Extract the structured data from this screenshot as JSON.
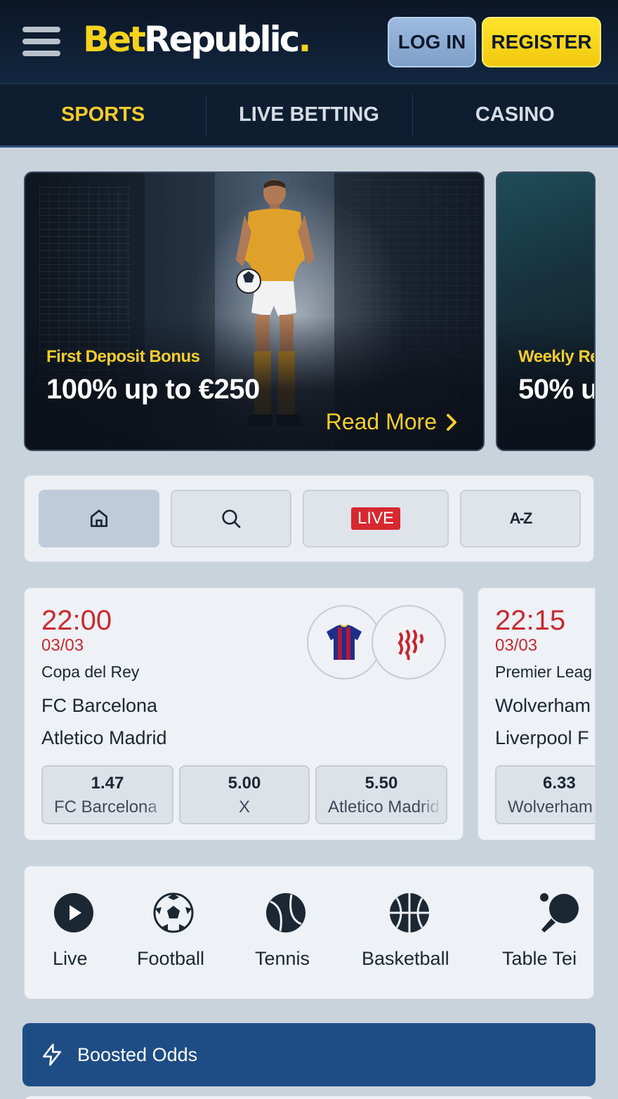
{
  "header": {
    "logo_part1": "Bet",
    "logo_part2": "Republic",
    "logo_dot": ".",
    "login_label": "LOG IN",
    "register_label": "REGISTER",
    "colors": {
      "brand_yellow": "#f7d21c",
      "header_bg": "#0c1626"
    }
  },
  "nav": {
    "tabs": [
      {
        "label": "SPORTS",
        "active": true
      },
      {
        "label": "LIVE BETTING",
        "active": false
      },
      {
        "label": "CASINO",
        "active": false
      }
    ]
  },
  "promos": [
    {
      "subtitle": "First Deposit Bonus",
      "title": "100% up to €250",
      "cta": "Read More"
    },
    {
      "subtitle": "Weekly Re",
      "title": "50% u"
    }
  ],
  "filters": {
    "items": [
      {
        "icon": "home-icon",
        "active": true
      },
      {
        "icon": "search-icon",
        "active": false
      },
      {
        "label": "LIVE",
        "active": false
      },
      {
        "label": "A-Z",
        "active": false
      }
    ]
  },
  "matches": [
    {
      "time": "22:00",
      "date": "03/03",
      "league": "Copa del Rey",
      "home": "FC Barcelona",
      "away": "Atletico Madrid",
      "odds": [
        {
          "value": "1.47",
          "label": "FC Barcelona"
        },
        {
          "value": "5.00",
          "label": "X"
        },
        {
          "value": "5.50",
          "label": "Atletico Madrid"
        }
      ]
    },
    {
      "time": "22:15",
      "date": "03/03",
      "league": "Premier Leag",
      "home": "Wolverham",
      "away": "Liverpool F",
      "odds": [
        {
          "value": "6.33",
          "label": "Wolverham"
        }
      ]
    }
  ],
  "sports": [
    {
      "label": "Live",
      "icon": "play-icon"
    },
    {
      "label": "Football",
      "icon": "football-icon"
    },
    {
      "label": "Tennis",
      "icon": "tennis-ball-icon"
    },
    {
      "label": "Basketball",
      "icon": "basketball-icon"
    },
    {
      "label": "Table Tei",
      "icon": "table-tennis-icon"
    }
  ],
  "boosted": {
    "label": "Boosted Odds",
    "icon": "lightning-icon"
  }
}
